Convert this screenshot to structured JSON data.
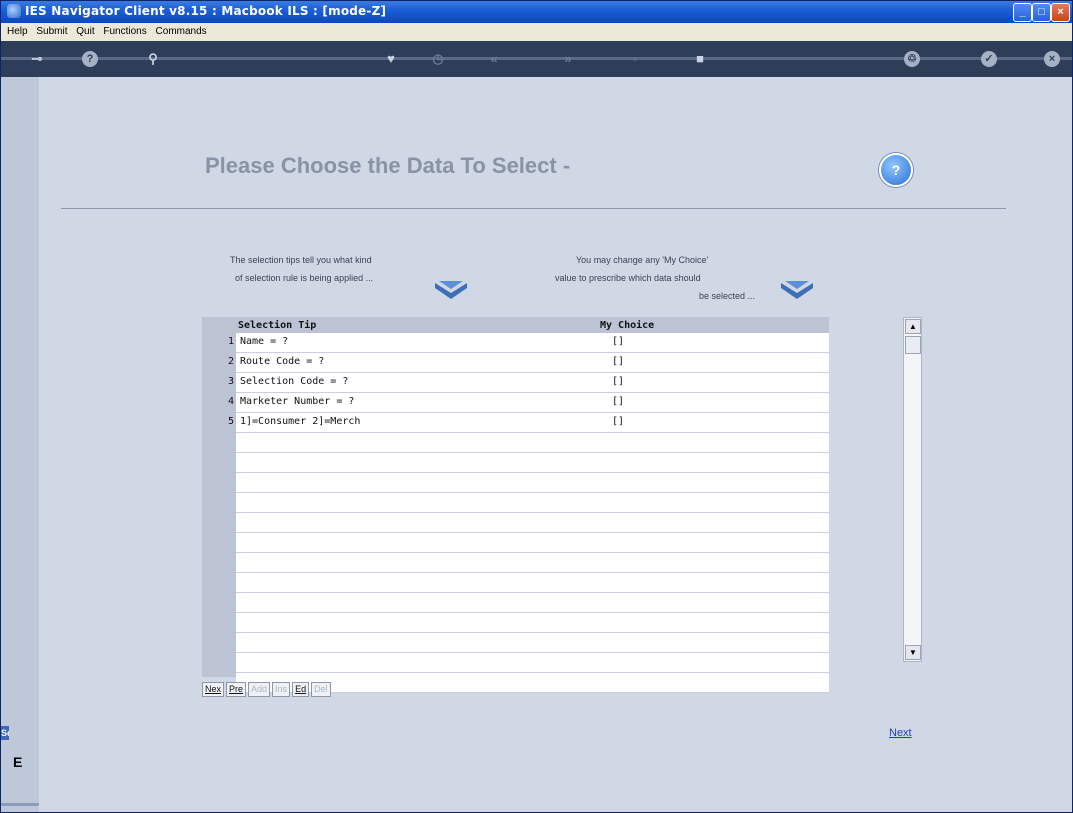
{
  "window": {
    "title": "IES Navigator Client v8.15 : Macbook ILS :      [mode-Z]"
  },
  "menu": [
    "Help",
    "Submit",
    "Quit",
    "Functions",
    "Commands"
  ],
  "toolbar_icons": [
    "key-icon",
    "help-icon",
    "search-icon",
    "heart-icon",
    "clock-icon",
    "rewind-icon",
    "forward-icon",
    "stop-icon",
    "square-icon",
    "recycle-icon",
    "check-icon",
    "close-icon"
  ],
  "page": {
    "heading": "Please Choose the Data To Select -",
    "tip_left_line1": "The selection tips tell you what kind",
    "tip_left_line2": "of selection rule is being applied ...",
    "tip_right_line1": "You may change any 'My Choice'",
    "tip_right_line2": "value to prescribe which data should",
    "tip_right_line3": "be selected ..."
  },
  "grid": {
    "col_tip": "Selection Tip",
    "col_choice": "My Choice",
    "rows": [
      {
        "num": "1",
        "tip": "Name = ?",
        "choice": "[]"
      },
      {
        "num": "2",
        "tip": "Route Code = ?",
        "choice": "[]"
      },
      {
        "num": "3",
        "tip": "Selection Code = ?",
        "choice": "[]"
      },
      {
        "num": "4",
        "tip": "Marketer Number = ?",
        "choice": "[]"
      },
      {
        "num": "5",
        "tip": "1]=Consumer 2]=Merch",
        "choice": "[]"
      }
    ]
  },
  "nav_buttons": {
    "nex": "Nex",
    "pre": "Pre",
    "add": "Add",
    "ins": "Ins",
    "ed": "Ed",
    "del": "Del"
  },
  "next_link": "Next",
  "side_label": "Se",
  "side_icon": "E"
}
